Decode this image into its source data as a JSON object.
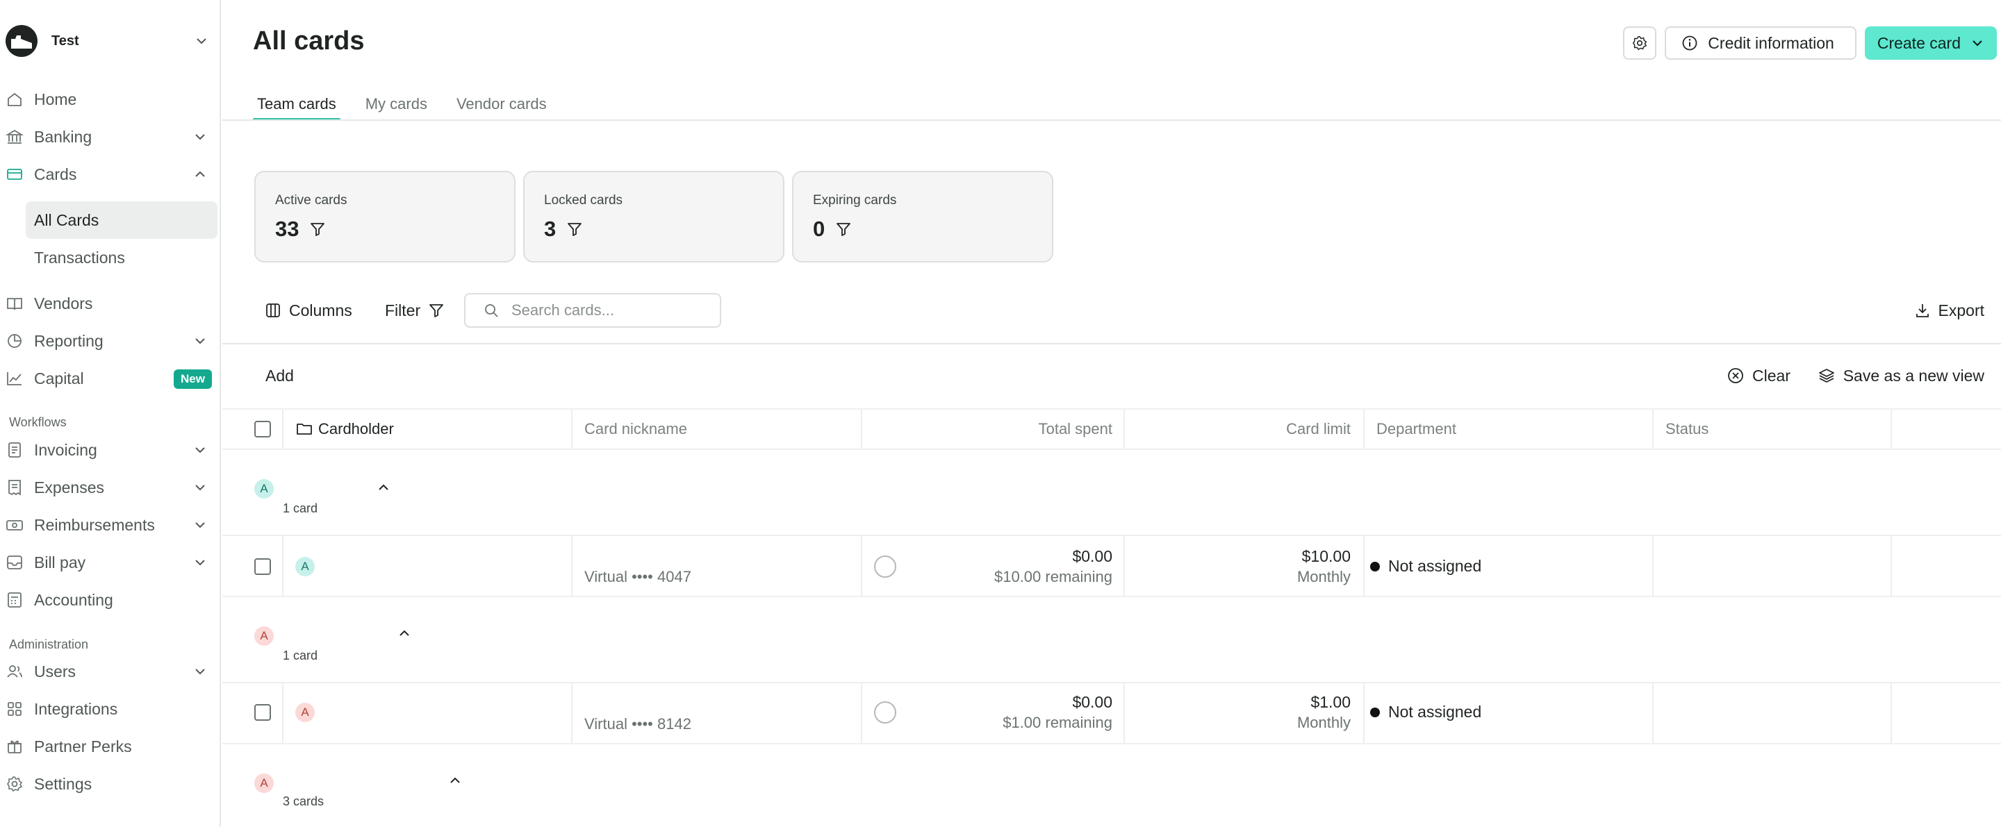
{
  "sidebar": {
    "org_name": "Test",
    "items": [
      {
        "label": "Home",
        "icon": "home-icon"
      },
      {
        "label": "Banking",
        "icon": "bank-icon"
      },
      {
        "label": "Cards",
        "icon": "card-icon"
      },
      {
        "label": "All Cards"
      },
      {
        "label": "Transactions"
      },
      {
        "label": "Vendors",
        "icon": "book-icon"
      },
      {
        "label": "Reporting",
        "icon": "pie-chart-icon"
      },
      {
        "label": "Capital",
        "icon": "trend-icon"
      },
      {
        "label": "Invoicing",
        "icon": "invoice-icon"
      },
      {
        "label": "Expenses",
        "icon": "receipt-icon"
      },
      {
        "label": "Reimbursements",
        "icon": "cash-icon"
      },
      {
        "label": "Bill pay",
        "icon": "inbox-icon"
      },
      {
        "label": "Accounting",
        "icon": "calculator-icon"
      },
      {
        "label": "Users",
        "icon": "users-icon"
      },
      {
        "label": "Integrations",
        "icon": "grid-icon"
      },
      {
        "label": "Partner Perks",
        "icon": "gift-icon"
      },
      {
        "label": "Settings",
        "icon": "gear-icon"
      }
    ],
    "workflows_label": "Workflows",
    "administration_label": "Administration",
    "new_badge": "New"
  },
  "header": {
    "title": "All cards",
    "credit_info_label": "Credit information",
    "create_card_label": "Create card"
  },
  "tabs": [
    "Team cards",
    "My cards",
    "Vendor cards"
  ],
  "stats": [
    {
      "title": "Active cards",
      "value": "33"
    },
    {
      "title": "Locked cards",
      "value": "3"
    },
    {
      "title": "Expiring cards",
      "value": "0"
    }
  ],
  "toolbar": {
    "columns_label": "Columns",
    "filter_label": "Filter",
    "search_placeholder": "Search cards...",
    "export_label": "Export"
  },
  "viewbar": {
    "add_label": "Add",
    "clear_label": "Clear",
    "save_view_label": "Save as a new view"
  },
  "table": {
    "columns": [
      "Cardholder",
      "Card nickname",
      "Total spent",
      "Card limit",
      "Department",
      "Status"
    ],
    "groups": [
      {
        "initial": "A",
        "count": "1 card"
      },
      {
        "initial": "A",
        "count": "1 card"
      },
      {
        "initial": "A",
        "count": "3 cards"
      }
    ],
    "rows": [
      {
        "initial": "A",
        "nickname": "Virtual •••• 4047",
        "spent": "$0.00",
        "remaining": "$10.00 remaining",
        "limit": "$10.00",
        "period": "Monthly",
        "department": "Not assigned"
      },
      {
        "initial": "A",
        "nickname": "Virtual •••• 8142",
        "spent": "$0.00",
        "remaining": "$1.00 remaining",
        "limit": "$1.00",
        "period": "Monthly",
        "department": "Not assigned"
      }
    ]
  },
  "colors": {
    "accent": "#5de8cf",
    "tab_underline": "#2fc3a9",
    "badge": "#14a98f"
  }
}
